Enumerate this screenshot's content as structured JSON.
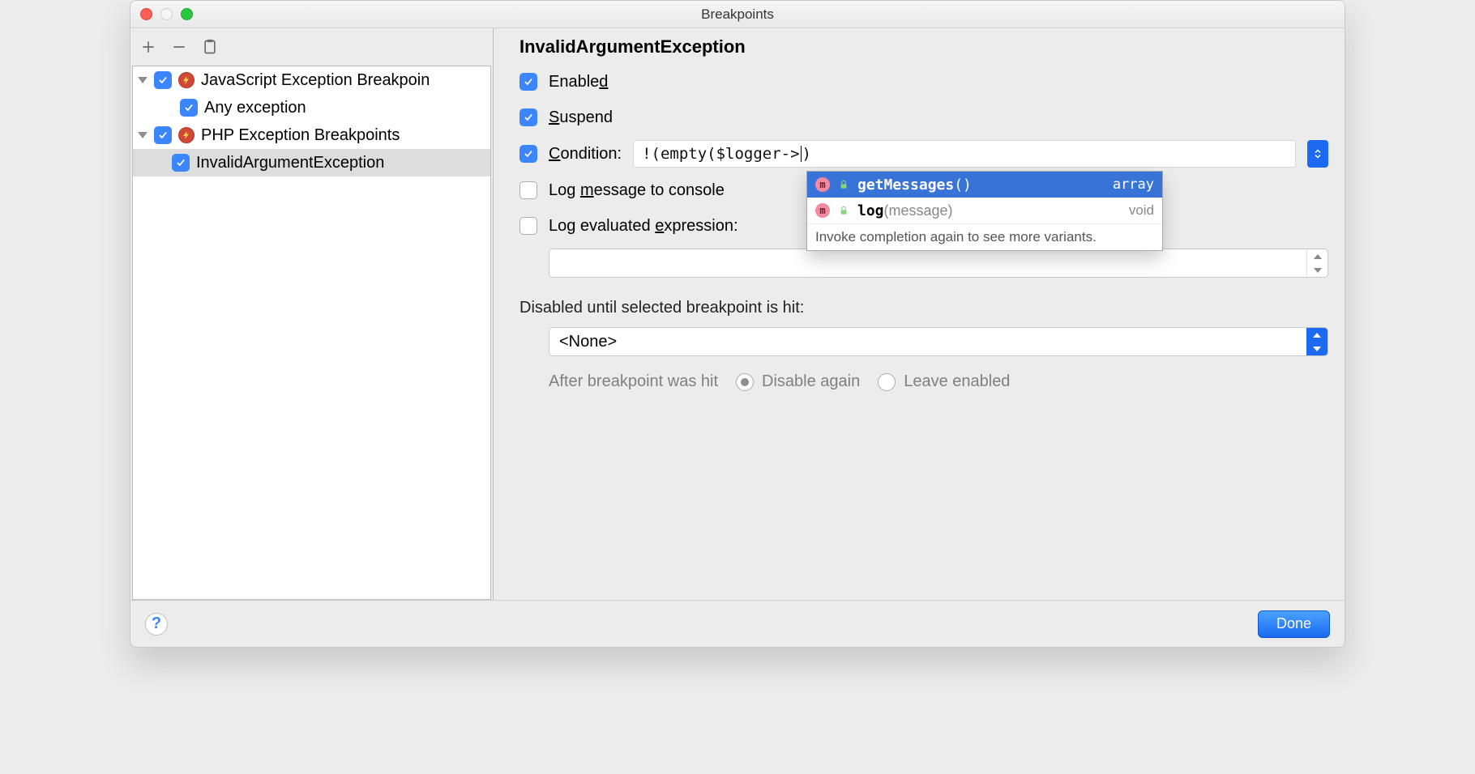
{
  "title": "Breakpoints",
  "tree": {
    "group1": "JavaScript Exception Breakpoin",
    "group1_child": "Any exception",
    "group2": "PHP Exception Breakpoints",
    "group2_child": "InvalidArgumentException"
  },
  "detail": {
    "heading": "InvalidArgumentException",
    "enabled_pre": "Enable",
    "enabled_u": "d",
    "suspend_u": "S",
    "suspend_post": "uspend",
    "condition_u": "C",
    "condition_post": "ondition:",
    "condition_value_pre": "!(empty($logger->",
    "condition_value_post": ")",
    "log_pre": "Log ",
    "log_u": "m",
    "log_post": "essage to console",
    "expr_pre": "Log evaluated ",
    "expr_u": "e",
    "expr_post": "xpression:",
    "disabled_until": "Disabled until selected breakpoint is hit:",
    "disabled_value": "<None>",
    "after_label": "After breakpoint was hit",
    "radio1": "Disable again",
    "radio2": "Leave enabled"
  },
  "completion": {
    "row1_name": "getMessages",
    "row1_sig": "()",
    "row1_ret": "array",
    "row2_name": "log",
    "row2_sig": "(message)",
    "row2_ret": "void",
    "footer": "Invoke completion again to see more variants."
  },
  "footer": {
    "done": "Done",
    "help": "?"
  }
}
